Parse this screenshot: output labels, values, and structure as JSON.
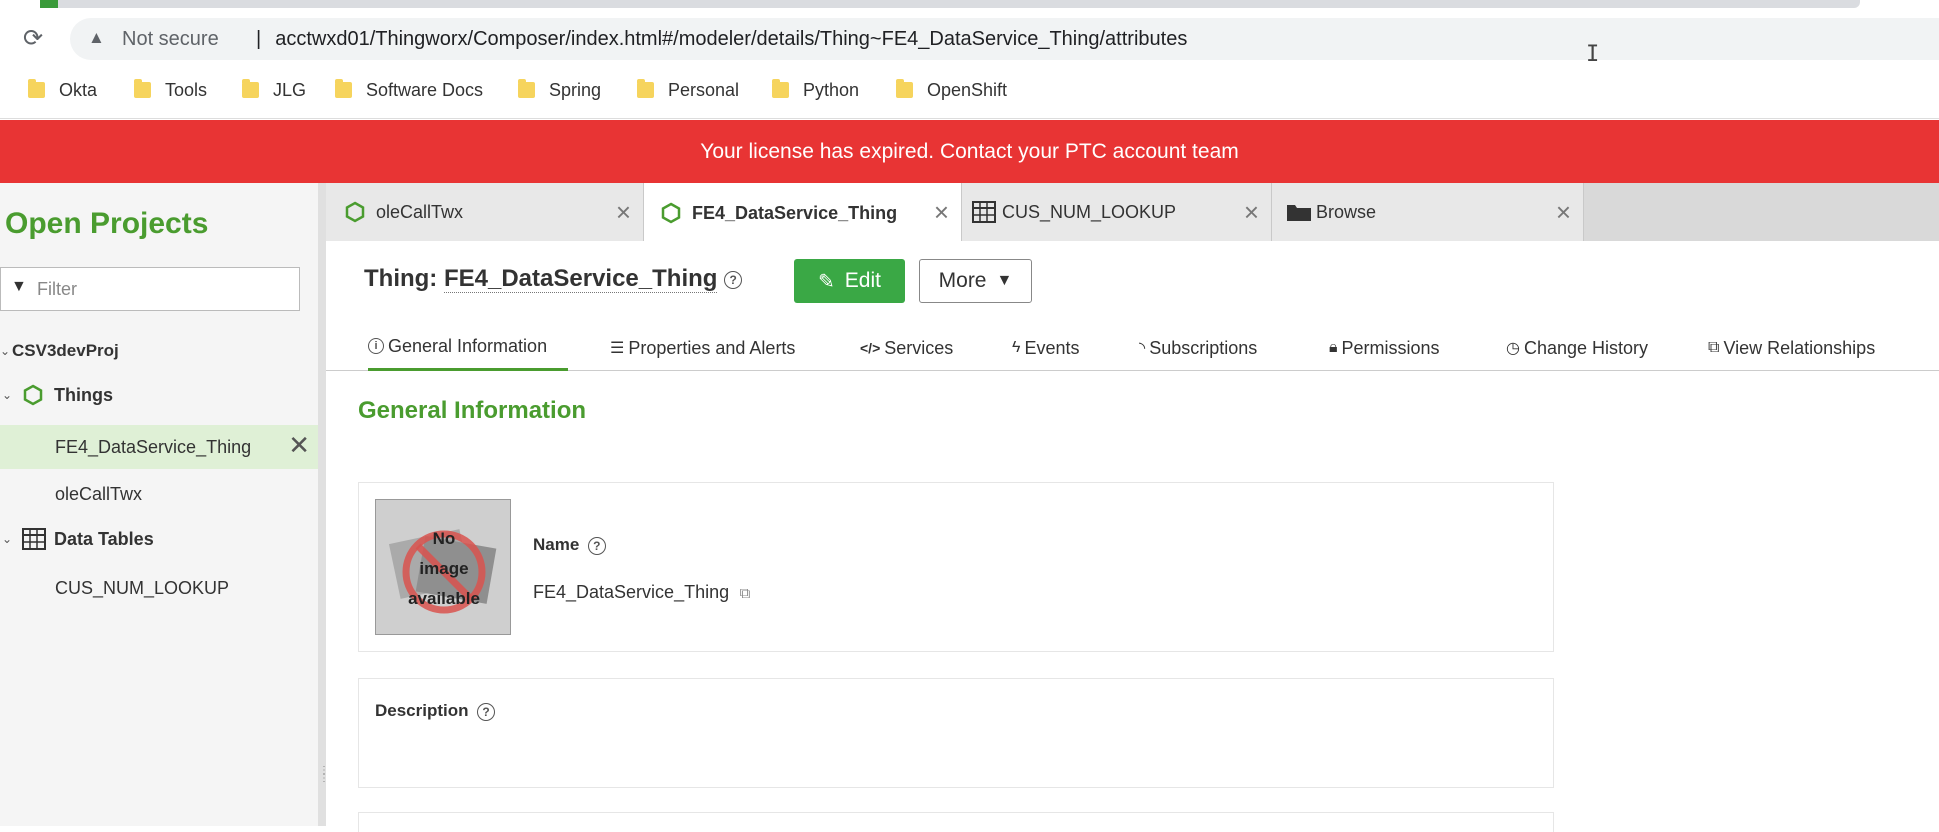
{
  "browser": {
    "security_label": "Not secure",
    "separator": "|",
    "url": "acctwxd01/Thingworx/Composer/index.html#/modeler/details/Thing~FE4_DataService_Thing/attributes",
    "bookmarks": [
      "Okta",
      "Tools",
      "JLG",
      "Software Docs",
      "Spring",
      "Personal",
      "Python",
      "OpenShift"
    ]
  },
  "banner": {
    "text": "Your license has expired. Contact your PTC account team"
  },
  "sidebar": {
    "title": "Open Projects",
    "filter_placeholder": "Filter",
    "project": "CSV3devProj",
    "groups": [
      {
        "label": "Things",
        "items": [
          "FE4_DataService_Thing",
          "oleCallTwx"
        ]
      },
      {
        "label": "Data Tables",
        "items": [
          "CUS_NUM_LOOKUP"
        ]
      }
    ],
    "selected_item": "FE4_DataService_Thing"
  },
  "tabs": [
    {
      "label": "oleCallTwx",
      "icon": "thing-icon",
      "active": false
    },
    {
      "label": "FE4_DataService_Thing",
      "icon": "thing-icon",
      "active": true
    },
    {
      "label": "CUS_NUM_LOOKUP",
      "icon": "table-icon",
      "active": false
    },
    {
      "label": "Browse",
      "icon": "folder-icon",
      "active": false
    }
  ],
  "header": {
    "entity_type": "Thing:",
    "entity_name": "FE4_DataService_Thing",
    "edit_label": "Edit",
    "more_label": "More"
  },
  "subnav": [
    {
      "label": "General Information",
      "icon": "info-icon",
      "active": true
    },
    {
      "label": "Properties and Alerts",
      "icon": "list-icon"
    },
    {
      "label": "Services",
      "icon": "code-icon"
    },
    {
      "label": "Events",
      "icon": "bolt-icon"
    },
    {
      "label": "Subscriptions",
      "icon": "feed-icon"
    },
    {
      "label": "Permissions",
      "icon": "lock-icon"
    },
    {
      "label": "Change History",
      "icon": "clock-icon"
    },
    {
      "label": "View Relationships",
      "icon": "sitemap-icon"
    }
  ],
  "general": {
    "section_title": "General Information",
    "no_image_text": [
      "No",
      "image",
      "available"
    ],
    "name_label": "Name",
    "name_value": "FE4_DataService_Thing",
    "description_label": "Description"
  },
  "colors": {
    "brand_green": "#4a9c2f",
    "edit_green": "#3aa845",
    "banner_red": "#e83434"
  }
}
